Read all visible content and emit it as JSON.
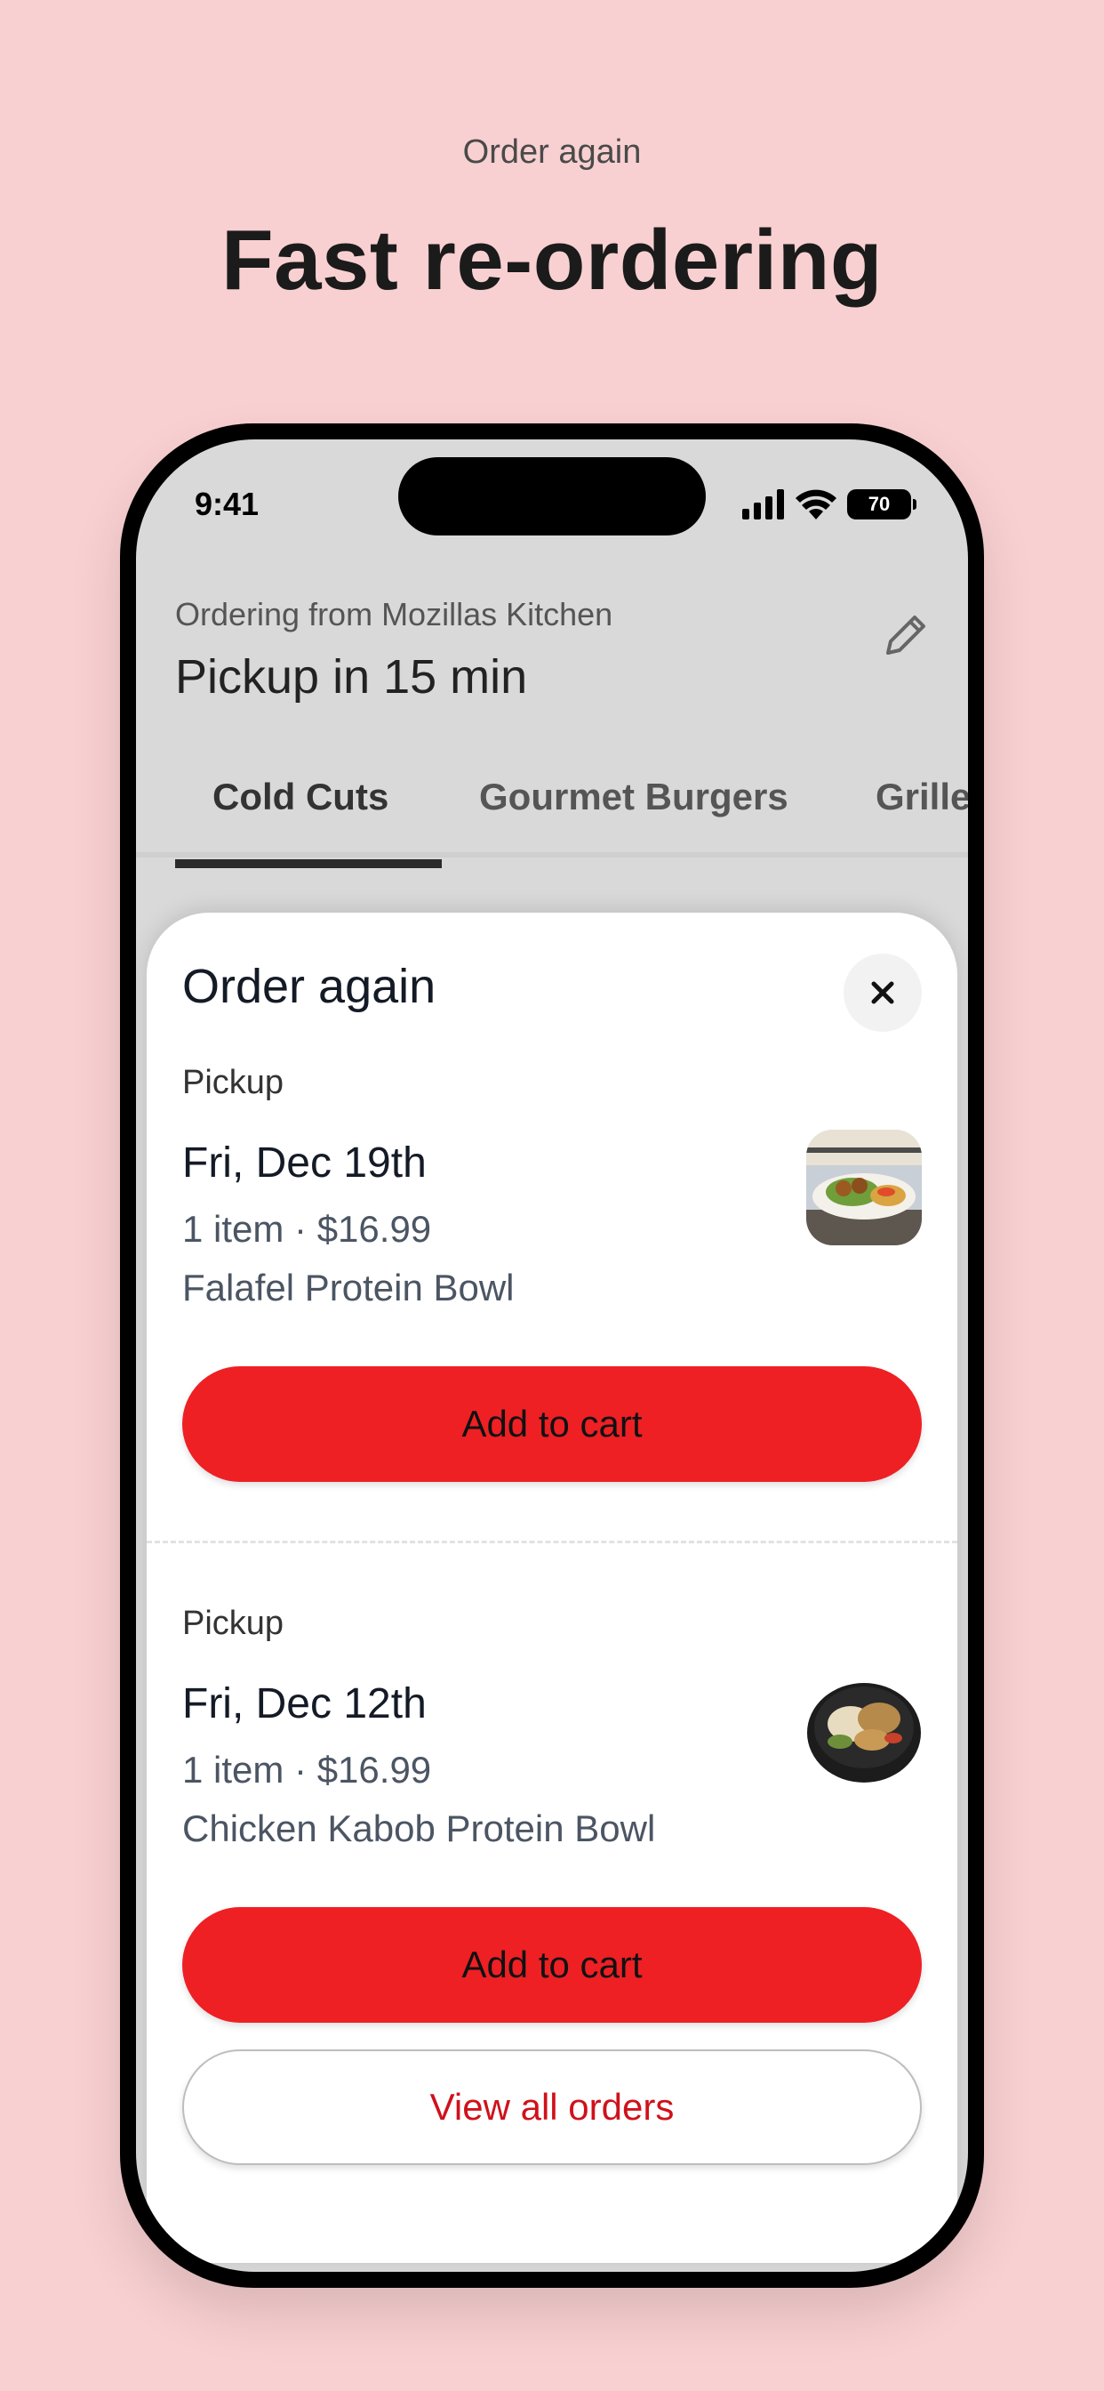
{
  "promo": {
    "eyebrow": "Order again",
    "title": "Fast re-ordering"
  },
  "status_bar": {
    "time": "9:41",
    "battery": "70",
    "icons": [
      "signal-icon",
      "wifi-icon",
      "battery-icon"
    ]
  },
  "header": {
    "subtitle": "Ordering from Mozillas Kitchen",
    "title": "Pickup in 15 min",
    "edit_icon": "pencil-icon"
  },
  "tabs": [
    {
      "label": "Cold Cuts",
      "active": true
    },
    {
      "label": "Gourmet Burgers",
      "active": false
    },
    {
      "label": "Grille",
      "active": false
    }
  ],
  "sheet": {
    "title": "Order again",
    "close_icon": "close-icon",
    "orders": [
      {
        "type": "Pickup",
        "date": "Fri, Dec 19th",
        "meta": "1 item · $16.99",
        "item": "Falafel Protein Bowl",
        "button": "Add to cart"
      },
      {
        "type": "Pickup",
        "date": "Fri, Dec 12th",
        "meta": "1 item · $16.99",
        "item": "Chicken Kabob Protein Bowl",
        "button": "Add to cart"
      }
    ],
    "view_all": "View all orders"
  },
  "colors": {
    "background": "#f9d0d1",
    "accent": "#ee2024",
    "link": "#d0111a"
  }
}
